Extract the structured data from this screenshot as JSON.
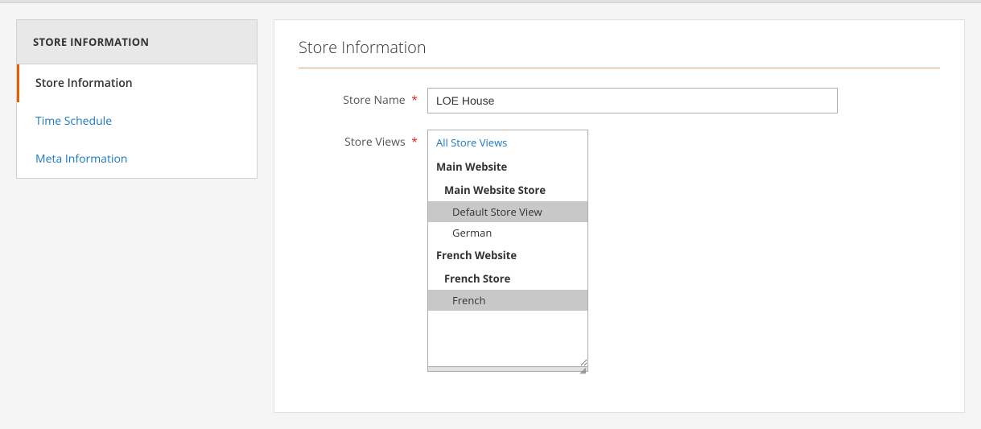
{
  "sidebar": {
    "header": "STORE INFORMATION",
    "items": [
      {
        "id": "store-information",
        "label": "Store Information",
        "active": true,
        "link": false
      },
      {
        "id": "time-schedule",
        "label": "Time Schedule",
        "active": false,
        "link": true
      },
      {
        "id": "meta-information",
        "label": "Meta Information",
        "active": false,
        "link": true
      }
    ]
  },
  "main": {
    "section_title": "Store Information",
    "fields": {
      "store_name": {
        "label": "Store Name",
        "value": "LOE House",
        "required": true
      },
      "store_views": {
        "label": "Store Views",
        "required": true,
        "options": [
          {
            "id": "all",
            "type": "all",
            "label": "All Store Views"
          },
          {
            "id": "main-website",
            "type": "group-header",
            "label": "Main Website"
          },
          {
            "id": "main-website-store",
            "type": "sub-group-header",
            "label": "Main Website Store"
          },
          {
            "id": "default-store-view",
            "type": "option",
            "label": "Default Store View",
            "selected": true
          },
          {
            "id": "german",
            "type": "option",
            "label": "German",
            "selected": false
          },
          {
            "id": "french-website",
            "type": "group-header",
            "label": "French Website"
          },
          {
            "id": "french-store",
            "type": "sub-group-header",
            "label": "French Store"
          },
          {
            "id": "french",
            "type": "option",
            "label": "French",
            "selected": true
          }
        ]
      }
    }
  },
  "required_label": "*"
}
